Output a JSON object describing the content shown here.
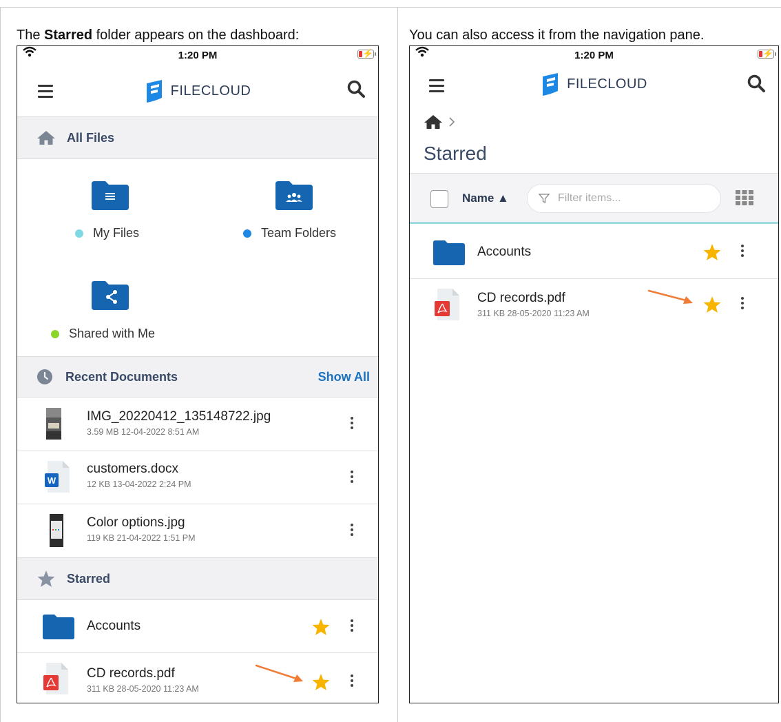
{
  "left_caption": {
    "prefix": "The ",
    "bold": "Starred",
    "suffix": " folder appears on the dashboard:"
  },
  "right_caption": "You can also access it from the navigation pane.",
  "status_bar": {
    "time": "1:20 PM"
  },
  "app": {
    "brand": "FILECLOUD"
  },
  "colors": {
    "folder_blue": "#1565b0",
    "star": "#f7b500",
    "accent": "#1a73c2",
    "arrow": "#f07c36"
  },
  "dashboard": {
    "all_files_header": "All Files",
    "tiles": [
      {
        "label": "My Files",
        "dot_color": "#7fd9e4",
        "icon": "folder-doc-icon"
      },
      {
        "label": "Team Folders",
        "dot_color": "#1e88e5",
        "icon": "folder-team-icon"
      },
      {
        "label": "Shared with Me",
        "dot_color": "#8bd42a",
        "icon": "folder-share-icon"
      }
    ],
    "recent_header": "Recent Documents",
    "show_all": "Show All",
    "recent": [
      {
        "name": "IMG_20220412_135148722.jpg",
        "meta": "3.59 MB 12-04-2022 8:51 AM",
        "icon": "image-thumbnail"
      },
      {
        "name": "customers.docx",
        "meta": "12 KB 13-04-2022 2:24 PM",
        "icon": "word-doc-icon"
      },
      {
        "name": "Color options.jpg",
        "meta": "119 KB 21-04-2022 1:51 PM",
        "icon": "image-thumbnail"
      }
    ],
    "starred_header": "Starred",
    "starred": [
      {
        "name": "Accounts",
        "meta": "",
        "icon": "folder-icon"
      },
      {
        "name": "CD records.pdf",
        "meta": "311 KB 28-05-2020 11:23 AM",
        "icon": "pdf-icon"
      }
    ]
  },
  "starred_page": {
    "title": "Starred",
    "sort_label": "Name ▲",
    "filter_placeholder": "Filter items...",
    "items": [
      {
        "name": "Accounts",
        "meta": "",
        "icon": "folder-icon"
      },
      {
        "name": "CD records.pdf",
        "meta": "311 KB 28-05-2020 11:23 AM",
        "icon": "pdf-icon"
      }
    ]
  }
}
